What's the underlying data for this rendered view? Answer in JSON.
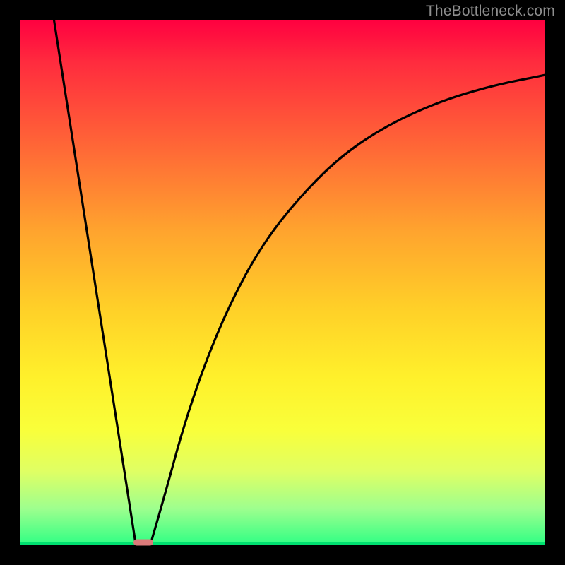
{
  "watermark": {
    "text": "TheBottleneck.com"
  },
  "chart_data": {
    "type": "line",
    "title": "",
    "xlabel": "",
    "ylabel": "",
    "xlim": [
      0,
      100
    ],
    "ylim": [
      0,
      100
    ],
    "grid": false,
    "legend": false,
    "series": [
      {
        "name": "left-line",
        "x": [
          6.5,
          22
        ],
        "values": [
          100,
          0.6
        ]
      },
      {
        "name": "right-curve",
        "x": [
          25,
          28,
          31,
          35,
          40,
          46,
          53,
          61,
          70,
          80,
          90,
          100
        ],
        "values": [
          0.6,
          11,
          22,
          34,
          46,
          57,
          66,
          74,
          80,
          84.5,
          87.5,
          89.5
        ]
      }
    ],
    "marker": {
      "x": 23.5,
      "y": 0.6,
      "color": "#db7a7a"
    },
    "background_gradient": {
      "top": "#ff0040",
      "bottom": "#2eff84"
    }
  }
}
